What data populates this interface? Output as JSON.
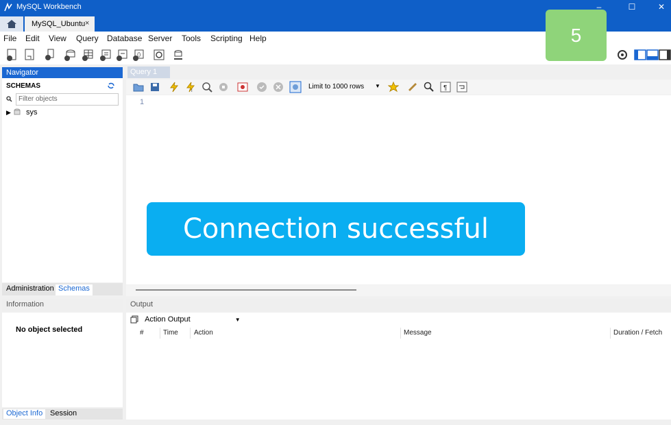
{
  "window": {
    "title": "MySQL Workbench",
    "minimize": "–",
    "maximize": "☐",
    "close": "✕"
  },
  "tabs": {
    "connection": "MySQL_Ubuntu",
    "close": "×"
  },
  "menu": [
    "File",
    "Edit",
    "View",
    "Query",
    "Database",
    "Server",
    "Tools",
    "Scripting",
    "Help"
  ],
  "badge": "5",
  "navigator": {
    "header": "Navigator",
    "schemas_title": "SCHEMAS",
    "filter_placeholder": "Filter objects",
    "tree": [
      {
        "label": "sys"
      }
    ]
  },
  "left_tabs": {
    "administration": "Administration",
    "schemas": "Schemas"
  },
  "information": {
    "header": "Information",
    "message": "No object selected"
  },
  "bottom_tabs": {
    "object_info": "Object Info",
    "session": "Session"
  },
  "query": {
    "tab": "Query 1",
    "tab_close": "×",
    "limit": "Limit to 1000 rows",
    "line": "1"
  },
  "output": {
    "header": "Output",
    "select": "Action Output",
    "columns": [
      "#",
      "Time",
      "Action",
      "Message",
      "Duration / Fetch"
    ]
  },
  "toast": "Connection successful",
  "colors": {
    "titlebar": "#0f5fc8",
    "badge": "#8fd47a",
    "toast": "#0aaef1"
  }
}
